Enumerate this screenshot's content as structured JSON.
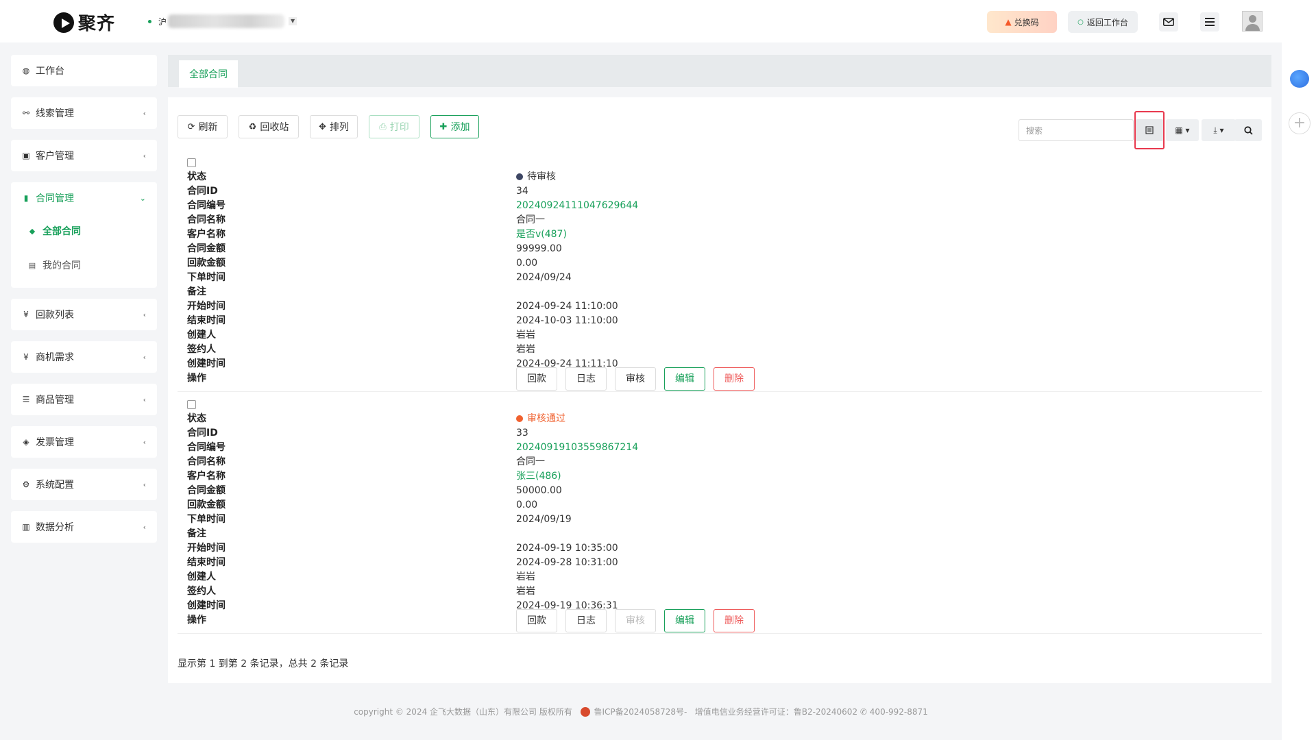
{
  "app": {
    "logo_text": "聚齐",
    "tenant_prefix": "沪"
  },
  "header": {
    "redeem_label": "兑换码",
    "back_label": "返回工作台"
  },
  "sidebar": {
    "items": [
      {
        "label": "工作台",
        "icon": "dashboard-icon"
      },
      {
        "label": "线索管理",
        "icon": "link-icon"
      },
      {
        "label": "客户管理",
        "icon": "id-card-icon"
      }
    ],
    "active_group": {
      "label": "合同管理",
      "children": [
        {
          "label": "全部合同",
          "active": true
        },
        {
          "label": "我的合同",
          "active": false
        }
      ]
    },
    "items_after": [
      {
        "label": "回款列表",
        "icon": "yen-icon"
      },
      {
        "label": "商机需求",
        "icon": "yen-icon"
      },
      {
        "label": "商品管理",
        "icon": "list-icon"
      },
      {
        "label": "发票管理",
        "icon": "tag-icon"
      },
      {
        "label": "系统配置",
        "icon": "gears-icon"
      },
      {
        "label": "数据分析",
        "icon": "bar-chart-icon"
      }
    ]
  },
  "tabs": [
    {
      "label": "全部合同"
    }
  ],
  "toolbar": {
    "refresh": "刷新",
    "recycle": "回收站",
    "arrange": "排列",
    "print": "打印",
    "add": "添加",
    "search_placeholder": "搜索"
  },
  "labels": {
    "status": "状态",
    "contract_id": "合同ID",
    "contract_no": "合同编号",
    "contract_name": "合同名称",
    "customer": "客户名称",
    "amount": "合同金额",
    "paid": "回款金额",
    "order_date": "下单时间",
    "remark": "备注",
    "start": "开始时间",
    "end": "结束时间",
    "creator": "创建人",
    "signer": "签约人",
    "created": "创建时间",
    "ops": "操作"
  },
  "ops": {
    "payment": "回款",
    "log": "日志",
    "review": "审核",
    "edit": "编辑",
    "delete": "删除"
  },
  "records": [
    {
      "status": "待审核",
      "status_color": "#3d4663",
      "contract_id": "34",
      "contract_no": "20240924111047629644",
      "contract_name": "合同一",
      "customer": "是否v(487)",
      "amount": "99999.00",
      "paid": "0.00",
      "order_date": "2024/09/24",
      "remark": "",
      "start": "2024-09-24 11:10:00",
      "end": "2024-10-03 11:10:00",
      "creator": "岩岩",
      "signer": "岩岩",
      "created": "2024-09-24 11:11:10",
      "review_disabled": false
    },
    {
      "status": "审核通过",
      "status_color": "#f0612f",
      "contract_id": "33",
      "contract_no": "20240919103559867214",
      "contract_name": "合同一",
      "customer": "张三(486)",
      "amount": "50000.00",
      "paid": "0.00",
      "order_date": "2024/09/19",
      "remark": "",
      "start": "2024-09-19 10:35:00",
      "end": "2024-09-28 10:31:00",
      "creator": "岩岩",
      "signer": "岩岩",
      "created": "2024-09-19 10:36:31",
      "review_disabled": true
    }
  ],
  "pager_text": "显示第 1 到第 2 条记录，总共 2 条记录",
  "footer": {
    "copyright": "copyright © 2024 企飞大数据（山东）有限公司 版权所有",
    "icp": "鲁ICP备2024058728号-",
    "license": "增值电信业务经营许可证：鲁B2-20240602",
    "phone": "400-992-8871"
  },
  "colors": {
    "accent": "#18a05a",
    "danger": "#ee5a5a",
    "highlight": "#e8394e"
  }
}
